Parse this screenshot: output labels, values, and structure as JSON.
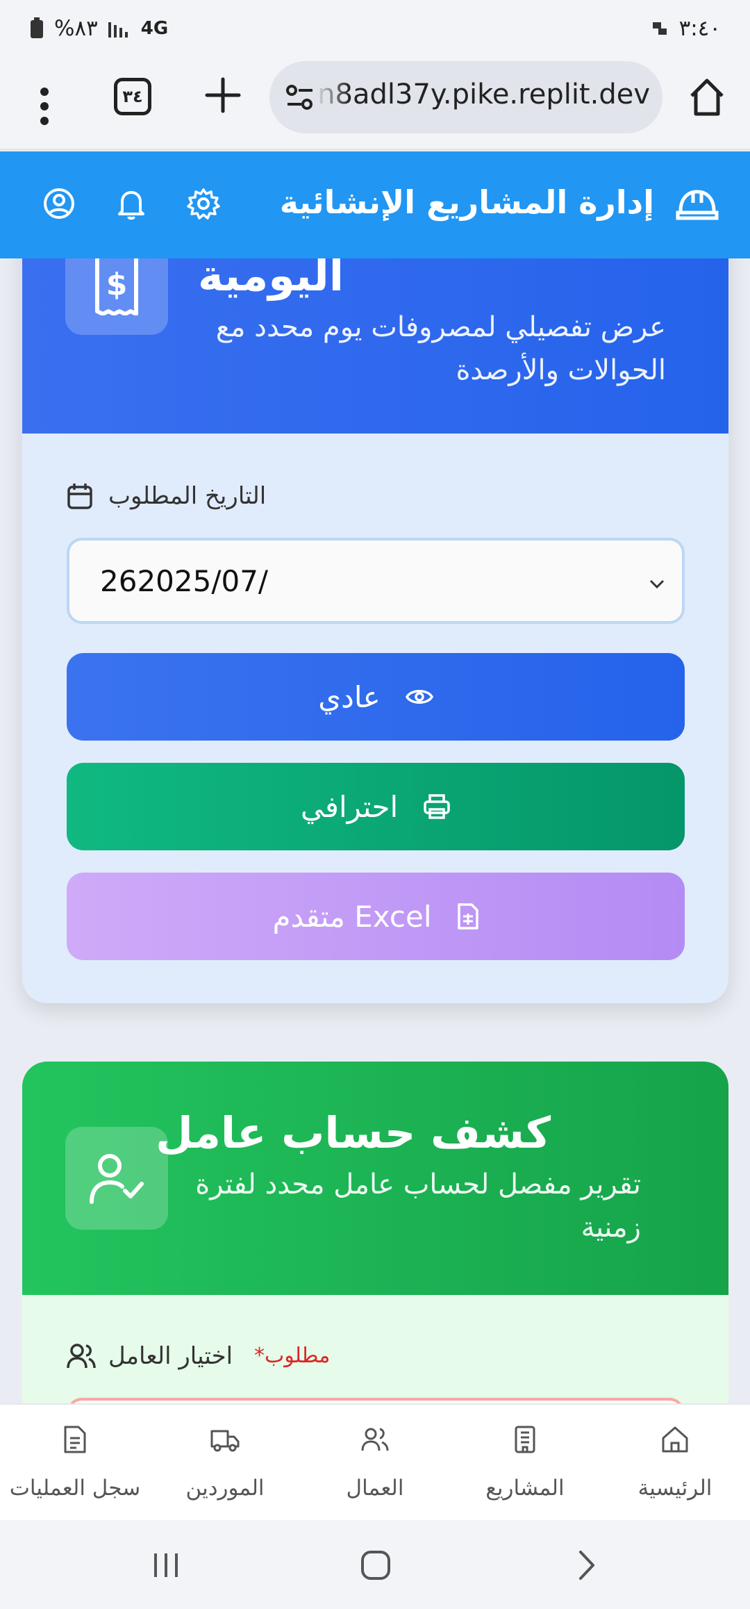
{
  "status_bar": {
    "time": "٣:٤٠",
    "battery": "%٨٣",
    "network": "4G"
  },
  "browser": {
    "url": "n8adl37y.pike.replit.dev",
    "tab_count": "٣٤"
  },
  "app_header": {
    "title": "إدارة المشاريع الإنشائية"
  },
  "daily_card": {
    "title": "اليومية",
    "description_line1": "عرض تفصيلي لمصروفات يوم محدد مع",
    "description_line2": "الحوالات والأرصدة",
    "date_label": "التاريخ المطلوب",
    "date_value": "262025/07/",
    "buttons": {
      "normal": "عادي",
      "professional": "احترافي",
      "advanced_excel": "متقدم Excel"
    }
  },
  "worker_card": {
    "title": "كشف حساب عامل",
    "description_line1": "تقرير مفصل لحساب عامل محدد لفترة",
    "description_line2": "زمنية",
    "worker_label": "اختيار العامل",
    "required_label": "مطلوب*"
  },
  "bottom_nav": {
    "items": [
      {
        "label": "الرئيسية",
        "icon": "home-icon"
      },
      {
        "label": "المشاريع",
        "icon": "building-icon"
      },
      {
        "label": "العمال",
        "icon": "users-icon"
      },
      {
        "label": "الموردين",
        "icon": "truck-icon"
      },
      {
        "label": "سجل العمليات",
        "icon": "document-icon"
      }
    ]
  },
  "colors": {
    "header_blue": "#2196f3",
    "daily_blue": "#2563eb",
    "pro_green": "#059669",
    "excel_purple": "#b48bf4",
    "worker_green": "#16a34a"
  }
}
